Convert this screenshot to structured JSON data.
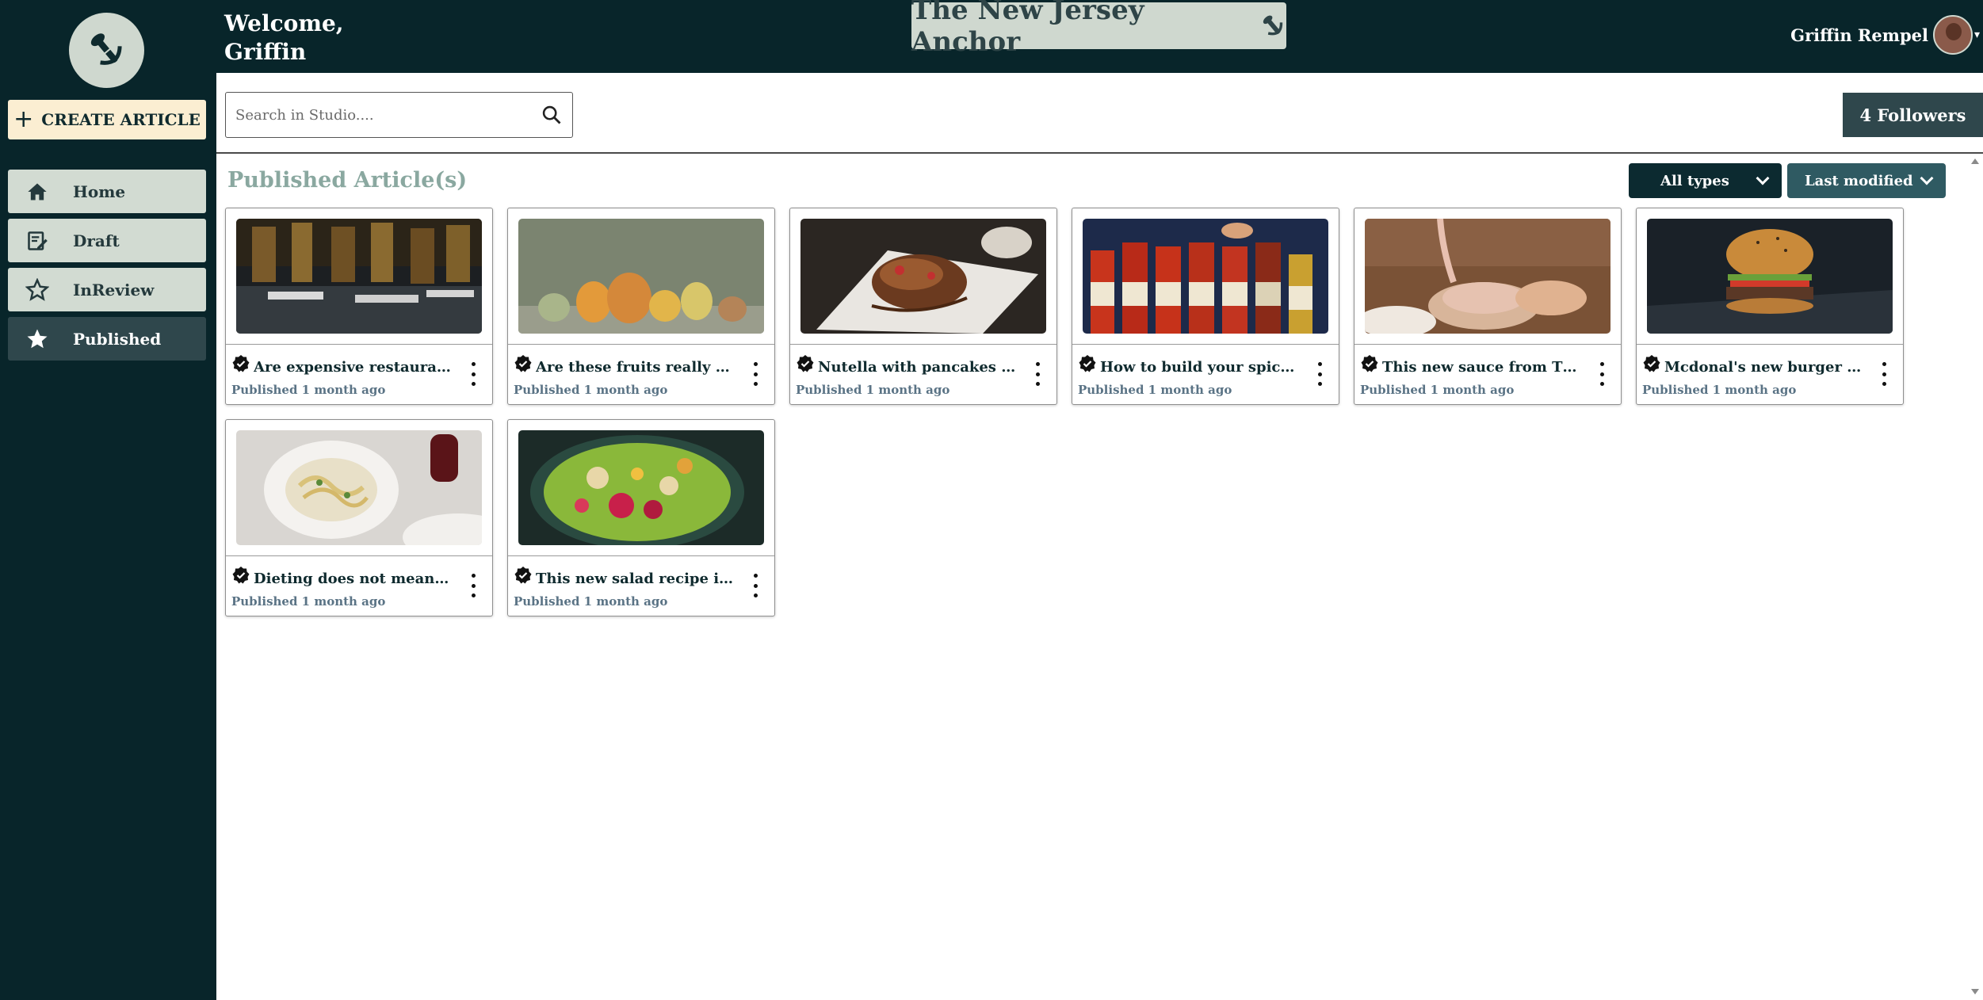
{
  "header": {
    "welcome_line1": "Welcome,",
    "welcome_line2": "Griffin",
    "brand_title": "The New Jersey Anchor",
    "user_name": "Griffin Rempel"
  },
  "sidebar": {
    "create_label": "CREATE ARTICLE",
    "items": [
      {
        "label": "Home",
        "icon": "home-icon"
      },
      {
        "label": "Draft",
        "icon": "draft-edit-icon"
      },
      {
        "label": "InReview",
        "icon": "star-outline-icon"
      },
      {
        "label": "Published",
        "icon": "star-filled-icon"
      }
    ]
  },
  "toolbar": {
    "search_placeholder": "Search in Studio....",
    "followers_label": "4 Followers"
  },
  "main": {
    "section_title": "Published Article(s)",
    "filter_types": "All types",
    "filter_sort": "Last modified",
    "articles": [
      {
        "title": "Are expensive restaurants worth it?",
        "status": "Published 1 month ago"
      },
      {
        "title": "Are these fruits really healthy?",
        "status": "Published 1 month ago"
      },
      {
        "title": "Nutella with pancakes is the best",
        "status": "Published 1 month ago"
      },
      {
        "title": "How to build your spicy food tolerance",
        "status": "Published 1 month ago"
      },
      {
        "title": "This new sauce from Tik Tok",
        "status": "Published 1 month ago"
      },
      {
        "title": "Mcdonal's new burger recipe",
        "status": "Published 1 month ago"
      },
      {
        "title": "Dieting does not mean you have to starve",
        "status": "Published 1 month ago"
      },
      {
        "title": "This new salad recipe is blowing up",
        "status": "Published 1 month ago"
      }
    ]
  },
  "colors": {
    "dark_teal": "#08252a",
    "sage": "#cfd8cf",
    "cream": "#fbeed2",
    "slate": "#2f474c",
    "muted_title": "#8aa8a0"
  }
}
